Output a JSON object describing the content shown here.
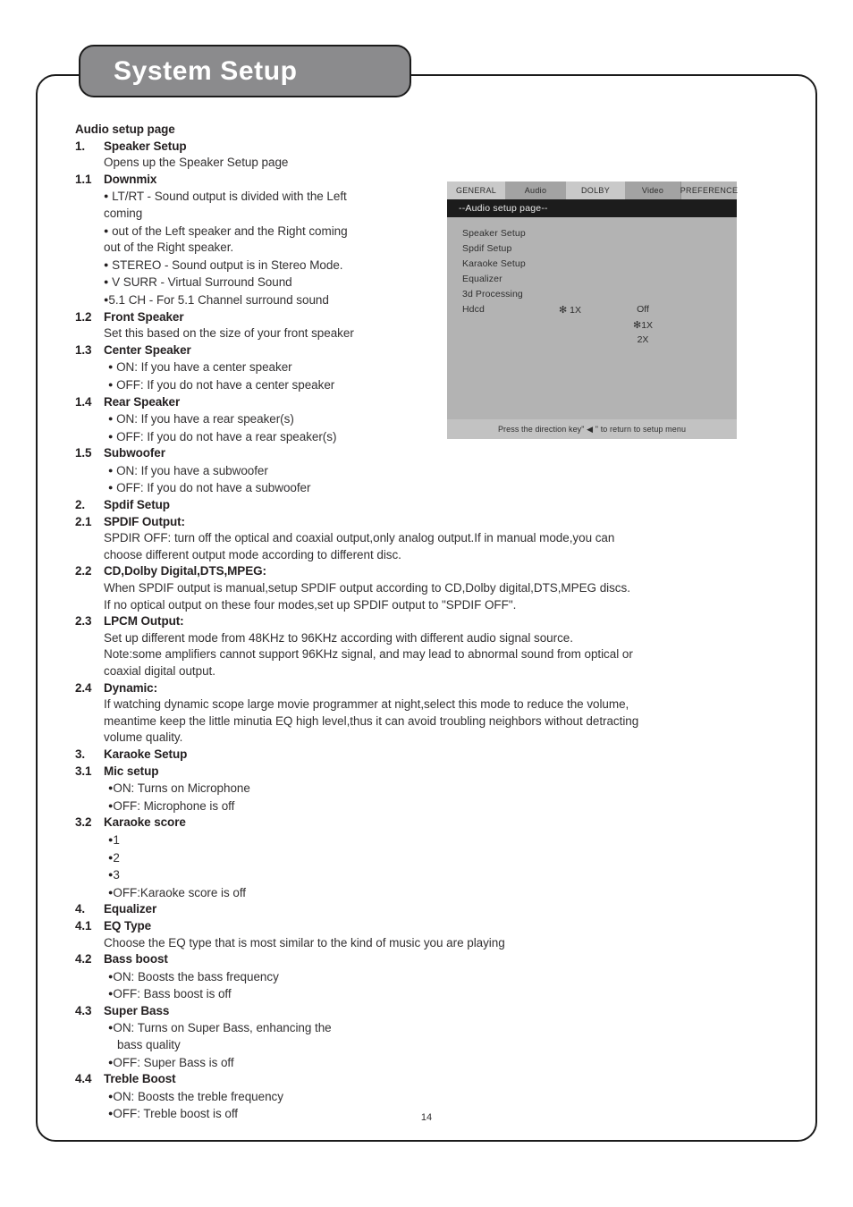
{
  "page": {
    "title": "System Setup",
    "number": "14"
  },
  "content": {
    "section_title": "Audio setup page",
    "blocks": [
      {
        "num": "1.",
        "title": "Speaker Setup"
      },
      {
        "desc": "Opens up the Speaker Setup page"
      },
      {
        "num": "1.1",
        "title": "Downmix"
      },
      {
        "bullet": "LT/RT - Sound output is divided with the Left"
      },
      {
        "cont": "coming"
      },
      {
        "bullet": "out of the Left speaker and the Right coming"
      },
      {
        "cont": "out of the Right speaker."
      },
      {
        "bullet": "STEREO - Sound output is in Stereo Mode."
      },
      {
        "bullet": "V SURR - Virtual Surround Sound"
      },
      {
        "bullet_tight": "5.1 CH - For 5.1 Channel surround sound"
      },
      {
        "num": "1.2",
        "title": "Front Speaker"
      },
      {
        "desc": "Set this based on the size of your front speaker"
      },
      {
        "num": "1.3",
        "title": "Center Speaker"
      },
      {
        "bullet_in": "ON: If you have a center speaker"
      },
      {
        "bullet_in2": "OFF: If you do not have a center speaker"
      },
      {
        "num": "1.4",
        "title": "Rear Speaker"
      },
      {
        "bullet_in": "ON: If you have a rear speaker(s)"
      },
      {
        "bullet_in": "OFF: If you do not have a rear speaker(s)"
      },
      {
        "num": "1.5",
        "title": "Subwoofer"
      },
      {
        "bullet_in": "ON: If you have a subwoofer"
      },
      {
        "bullet_in": "OFF: If you do not have a subwoofer"
      },
      {
        "num": "2.",
        "title": "Spdif Setup"
      },
      {
        "num": "2.1",
        "title": "SPDIF Output:"
      },
      {
        "para": "SPDIR OFF: turn off the optical and coaxial output,only analog output.If in manual mode,you can"
      },
      {
        "para": "choose different output mode according to different disc."
      },
      {
        "num": "2.2",
        "title": "CD,Dolby Digital,DTS,MPEG:"
      },
      {
        "para": "When SPDIF output is manual,setup SPDIF output according to CD,Dolby digital,DTS,MPEG discs."
      },
      {
        "para": "If no optical output on these four modes,set up SPDIF output to \"SPDIF OFF\"."
      },
      {
        "num": "2.3",
        "title": "LPCM Output:"
      },
      {
        "para": "Set up different mode from 48KHz to 96KHz according with different audio signal source."
      },
      {
        "para": "Note:some amplifiers cannot support 96KHz signal, and may lead to abnormal sound from optical or"
      },
      {
        "para": "coaxial digital output."
      },
      {
        "num": "2.4",
        "title": "Dynamic:"
      },
      {
        "para": "If watching dynamic scope large movie programmer at night,select this mode to reduce the volume,"
      },
      {
        "para": "meantime keep the little minutia EQ high level,thus it can avoid troubling neighbors without detracting"
      },
      {
        "para": "volume quality."
      },
      {
        "num": "3.",
        "title": "Karaoke Setup"
      },
      {
        "num": "3.1",
        "title": "Mic setup"
      },
      {
        "bullet_tight_in": "ON: Turns on Microphone"
      },
      {
        "bullet_tight_in": "OFF: Microphone is off"
      },
      {
        "num": "3.2",
        "title": "Karaoke score"
      },
      {
        "bullet_tight_in": "1"
      },
      {
        "bullet_tight_in": "2"
      },
      {
        "bullet_tight_in": "3"
      },
      {
        "bullet_tight_in": "OFF:Karaoke score is off"
      },
      {
        "num": "4.",
        "title": "Equalizer"
      },
      {
        "num": "4.1",
        "title": "EQ Type"
      },
      {
        "desc": "Choose the EQ type that is most similar to the kind of music you are playing"
      },
      {
        "num": "4.2",
        "title": "Bass boost"
      },
      {
        "bullet_tight_in": "ON: Boosts the bass frequency"
      },
      {
        "bullet_tight_in": "OFF: Bass boost is off"
      },
      {
        "num": "4.3",
        "title": "Super Bass"
      },
      {
        "bullet_tight_in": "ON: Turns on Super Bass, enhancing the"
      },
      {
        "cont2": "bass quality"
      },
      {
        "bullet_tight_in": "OFF: Super Bass is off"
      },
      {
        "num": "4.4",
        "title": "Treble Boost"
      },
      {
        "bullet_tight_in": "ON: Boosts the treble frequency"
      },
      {
        "bullet_tight_in": "OFF: Treble boost is off"
      }
    ]
  },
  "osd": {
    "tabs": [
      "GENERAL",
      "Audio",
      "DOLBY",
      "Video",
      "PREFERENCE"
    ],
    "page_header": "--Audio setup page--",
    "menu_items": [
      "Speaker Setup",
      "Spdif Setup",
      "Karaoke Setup",
      "Equalizer",
      "3d Processing",
      "Hdcd"
    ],
    "hdcd_current": "1X",
    "hdcd_current_marker": "✻",
    "options": [
      {
        "label": "Off",
        "marker": ""
      },
      {
        "label": "1X",
        "marker": "✻"
      },
      {
        "label": "2X",
        "marker": ""
      }
    ],
    "footer": "Press the direction key\" ◀ \" to return to setup menu"
  }
}
